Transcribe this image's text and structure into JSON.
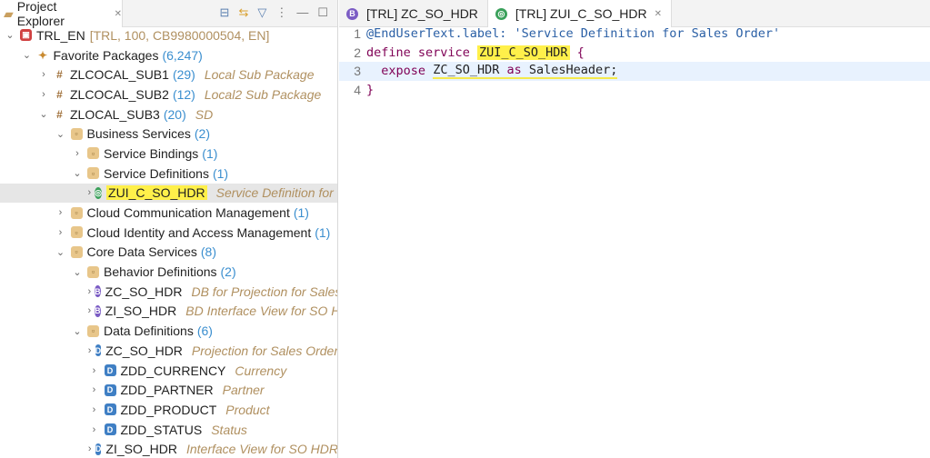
{
  "explorer": {
    "title": "Project Explorer",
    "tree": [
      {
        "level": 0,
        "open": true,
        "icon": "project",
        "name": "TRL_EN",
        "desc": "[TRL, 100, CB9980000504, EN]",
        "plain": true
      },
      {
        "level": 1,
        "open": true,
        "icon": "favorites",
        "name": "Favorite Packages",
        "count": "(6,247)"
      },
      {
        "level": 2,
        "open": false,
        "icon": "package",
        "name": "ZLCOCAL_SUB1",
        "count": "(29)",
        "desc": "Local Sub Package"
      },
      {
        "level": 2,
        "open": false,
        "icon": "package",
        "name": "ZLCOCAL_SUB2",
        "count": "(12)",
        "desc": "Local2 Sub Package"
      },
      {
        "level": 2,
        "open": true,
        "icon": "package",
        "name": "ZLOCAL_SUB3",
        "count": "(20)",
        "desc": "SD"
      },
      {
        "level": 3,
        "open": true,
        "icon": "folder",
        "name": "Business Services",
        "count": "(2)"
      },
      {
        "level": 4,
        "open": false,
        "icon": "folder",
        "name": "Service Bindings",
        "count": "(1)"
      },
      {
        "level": 4,
        "open": true,
        "icon": "folder",
        "name": "Service Definitions",
        "count": "(1)"
      },
      {
        "level": 5,
        "open": false,
        "icon": "service",
        "name": "ZUI_C_SO_HDR",
        "desc": "Service Definition for Sales Order",
        "selected": true
      },
      {
        "level": 3,
        "open": false,
        "icon": "folder",
        "name": "Cloud Communication Management",
        "count": "(1)"
      },
      {
        "level": 3,
        "open": false,
        "icon": "folder",
        "name": "Cloud Identity and Access Management",
        "count": "(1)"
      },
      {
        "level": 3,
        "open": true,
        "icon": "folder",
        "name": "Core Data Services",
        "count": "(8)"
      },
      {
        "level": 4,
        "open": true,
        "icon": "folder",
        "name": "Behavior Definitions",
        "count": "(2)"
      },
      {
        "level": 5,
        "open": false,
        "icon": "behavior",
        "name": "ZC_SO_HDR",
        "desc": "DB for Projection for Sales"
      },
      {
        "level": 5,
        "open": false,
        "icon": "behavior",
        "name": "ZI_SO_HDR",
        "desc": "BD Interface View for SO HDR"
      },
      {
        "level": 4,
        "open": true,
        "icon": "folder",
        "name": "Data Definitions",
        "count": "(6)"
      },
      {
        "level": 5,
        "open": false,
        "icon": "ddl",
        "name": "ZC_SO_HDR",
        "desc": "Projection for Sales Order"
      },
      {
        "level": 5,
        "open": false,
        "icon": "ddl",
        "name": "ZDD_CURRENCY",
        "desc": "Currency"
      },
      {
        "level": 5,
        "open": false,
        "icon": "ddl",
        "name": "ZDD_PARTNER",
        "desc": "Partner"
      },
      {
        "level": 5,
        "open": false,
        "icon": "ddl",
        "name": "ZDD_PRODUCT",
        "desc": "Product"
      },
      {
        "level": 5,
        "open": false,
        "icon": "ddl",
        "name": "ZDD_STATUS",
        "desc": "Status"
      },
      {
        "level": 5,
        "open": false,
        "icon": "ddl",
        "name": "ZI_SO_HDR",
        "desc": "Interface View for SO HDR"
      }
    ]
  },
  "editor": {
    "tabs": [
      {
        "label": "[TRL] ZC_SO_HDR",
        "icon": "behavior"
      },
      {
        "label": "[TRL] ZUI_C_SO_HDR",
        "icon": "service"
      }
    ],
    "code": {
      "l1": "@EndUserText.label: 'Service Definition for Sales Order'",
      "define": "define",
      "service": "service",
      "name": "ZUI_C_SO_HDR",
      "brace_open": "{",
      "expose": "expose",
      "entity": "ZC_SO_HDR",
      "as": "as",
      "alias": "SalesHeader;",
      "brace_close": "}"
    }
  }
}
